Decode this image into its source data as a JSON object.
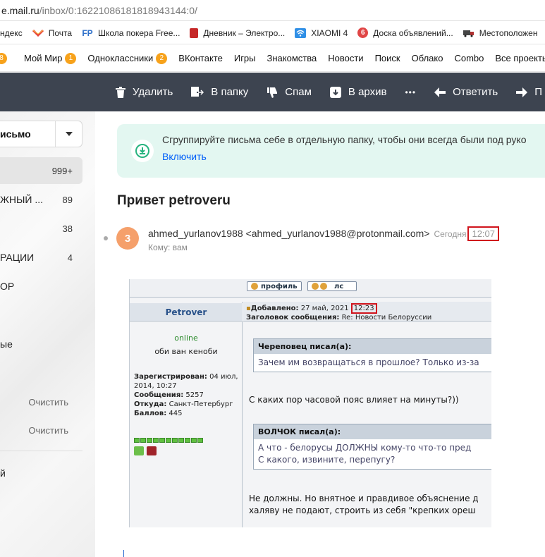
{
  "address_bar": {
    "host": "e.mail.ru",
    "path": "/inbox/0:16221086181818943144:0/"
  },
  "bookmarks": [
    {
      "label": "ндекс",
      "icon": "yandex-icon",
      "color": ""
    },
    {
      "label": "Почта",
      "icon": "mail-icon",
      "color": "#e8453c"
    },
    {
      "label": "Школа покера Free...",
      "icon": "fp-icon",
      "color": "#2d6fc9",
      "glyph": "FP"
    },
    {
      "label": "Дневник – Электро...",
      "icon": "diary-icon",
      "color": "#c62828"
    },
    {
      "label": "XIAOMI 4",
      "icon": "wifi-icon",
      "color": "#2f8fe6"
    },
    {
      "label": "Доска объявлений...",
      "icon": "board-icon",
      "color": "#e04545",
      "glyph": "6"
    },
    {
      "label": "Местоположен",
      "icon": "truck-icon",
      "color": "#b03030"
    }
  ],
  "portal_nav": {
    "lead_badge": "8",
    "items": [
      {
        "label": "Мой Мир",
        "badge": "1"
      },
      {
        "label": "Одноклассники",
        "badge": "2"
      },
      {
        "label": "ВКонтакте",
        "badge": ""
      },
      {
        "label": "Игры",
        "badge": ""
      },
      {
        "label": "Знакомства",
        "badge": ""
      },
      {
        "label": "Новости",
        "badge": ""
      },
      {
        "label": "Поиск",
        "badge": ""
      },
      {
        "label": "Облако",
        "badge": ""
      },
      {
        "label": "Combo",
        "badge": ""
      },
      {
        "label": "Все проекты",
        "badge": ""
      }
    ]
  },
  "toolbar": {
    "delete_label": "Удалить",
    "move_label": "В папку",
    "spam_label": "Спам",
    "archive_label": "В архив",
    "more_label": "•••",
    "reply_label": "Ответить",
    "forward_label": "П"
  },
  "sidebar": {
    "write_label": "исьмо",
    "folders": [
      {
        "label": "",
        "count": "999+"
      },
      {
        "label": "ЖНЫЙ ...",
        "count": "89"
      },
      {
        "label": "",
        "count": "38"
      },
      {
        "label": "РАЦИИ",
        "count": "4"
      },
      {
        "label": "ОР",
        "count": ""
      },
      {
        "label": "",
        "count": ""
      },
      {
        "label": "ые",
        "count": ""
      }
    ],
    "clear_label_1": "Очистить",
    "clear_label_2": "Очистить",
    "bottom_label": "й"
  },
  "notice": {
    "text": "Сгруппируйте письма себе в отдельную папку, чтобы они всегда были под руко",
    "link": "Включить"
  },
  "message": {
    "subject": "Привет petroveru",
    "avatar_letter": "3",
    "sender": "ahmed_yurlanov1988 <ahmed_yurlanov1988@protonmail.com>",
    "when": "Сегодня",
    "time": "12:07",
    "to": "Кому: вам"
  },
  "forum": {
    "profile_btn": "профиль",
    "pm_btn": "лс",
    "username": "Petrover",
    "status": "online",
    "rank": "оби ван кеноби",
    "registered_label": "Зарегистрирован:",
    "registered_value": "04 июл, 2014, 10:27",
    "posts_label": "Сообщения:",
    "posts_value": "5257",
    "from_label": "Откуда:",
    "from_value": "Санкт-Петербург",
    "points_label": "Баллов:",
    "points_value": "445",
    "added_label": "Добавлено:",
    "added_date": "27 май, 2021",
    "added_time": "12:23",
    "subject_label": "Заголовок сообщения:",
    "subject_value": "Re: Новости Белоруссии",
    "quote1_author": "Череповец писал(а):",
    "quote1_text": "Зачем им возвращаться в прошлое? Только из-за",
    "text1": "С каких пор часовой пояс влияет на минуты?))",
    "quote2_author": "ВОЛЧОК писал(а):",
    "quote2_line1": "А что - белорусы ДОЛЖНЫ кому-то что-то пред",
    "quote2_line2": "С какого, извините, перепугу?",
    "text2_line1": "Не должны. Но внятное и правдивое объяснение д",
    "text2_line2": "халяву не подают, строить из себя \"крепких ореш"
  }
}
